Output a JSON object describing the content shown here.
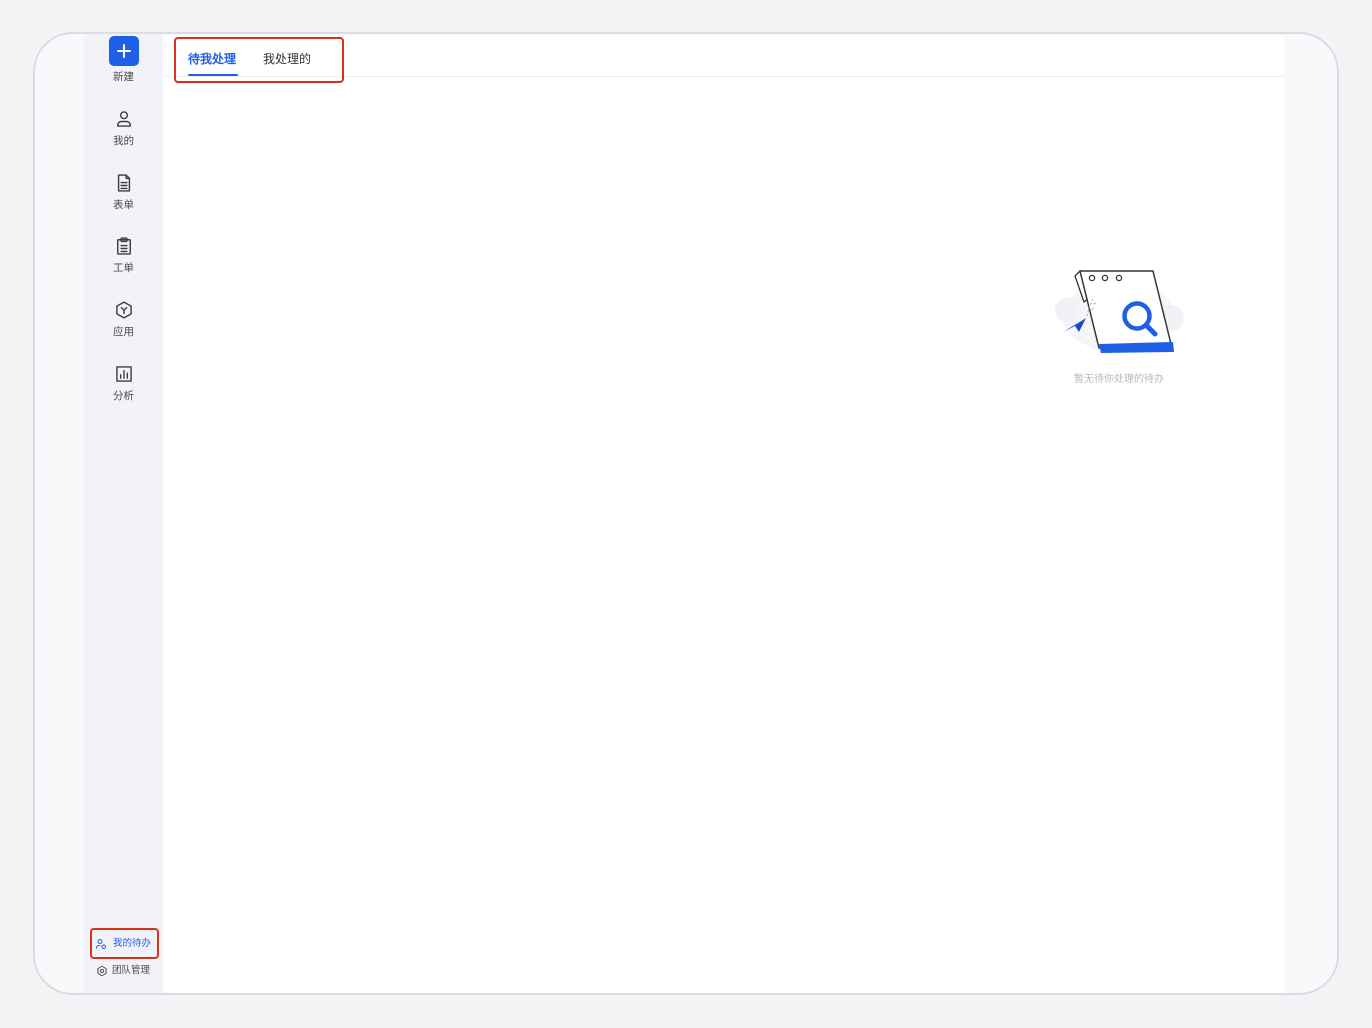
{
  "sidebar": {
    "new_button": {
      "label": "新建",
      "icon": "plus-icon"
    },
    "items": [
      {
        "label": "我的",
        "icon": "user-icon"
      },
      {
        "label": "表单",
        "icon": "document-icon"
      },
      {
        "label": "工单",
        "icon": "clipboard-icon"
      },
      {
        "label": "应用",
        "icon": "hexagon-icon"
      },
      {
        "label": "分析",
        "icon": "bar-chart-icon"
      }
    ],
    "bottom": {
      "my_todo": {
        "label": "我的待办",
        "icon": "user-todo-icon",
        "active": true
      },
      "team_management": {
        "label": "团队管理",
        "icon": "gear-icon"
      }
    }
  },
  "tabs": [
    {
      "label": "待我处理",
      "active": true
    },
    {
      "label": "我处理的",
      "active": false
    }
  ],
  "empty_state": {
    "message": "暂无待你处理的待办",
    "illustration": "empty-search-illustration"
  },
  "colors": {
    "accent": "#1f5fe8",
    "highlight": "#d8321f",
    "sidebar_bg": "#f2f3f8"
  }
}
